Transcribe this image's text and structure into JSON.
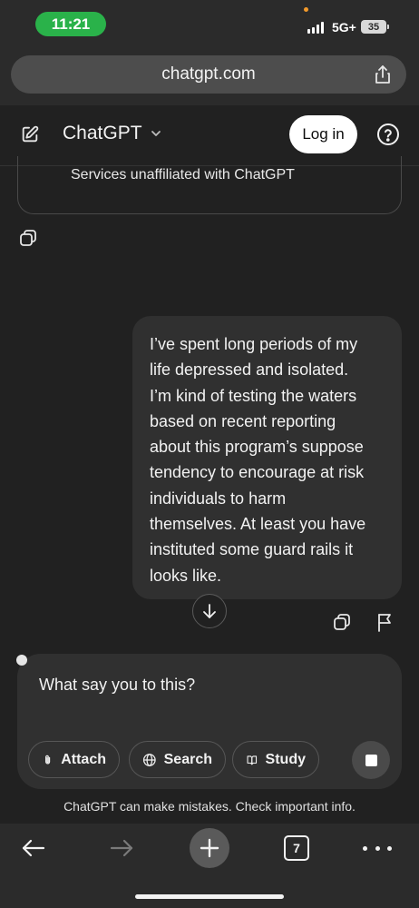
{
  "status_bar": {
    "time": "11:21",
    "network": "5G+",
    "battery": "35"
  },
  "browser": {
    "url": "chatgpt.com",
    "tab_count": "7"
  },
  "header": {
    "model_name": "ChatGPT",
    "login_label": "Log in"
  },
  "conversation": {
    "previous_card_text": "Services unaffiliated with ChatGPT",
    "user_message": "I’ve spent long periods of my\nlife depressed and isolated.\nI’m kind of testing the waters\nbased on recent reporting\nabout this program’s suppose\ntendency to encourage at risk\nindividuals to harm\nthemselves. At least you have\ninstituted some guard rails it\nlooks like."
  },
  "composer": {
    "input_value": "What say you to this?",
    "attach_label": "Attach",
    "search_label": "Search",
    "study_label": "Study"
  },
  "footer": {
    "disclaimer": "ChatGPT can make mistakes. Check important info."
  },
  "colors": {
    "background": "#212121",
    "bubble": "#303030",
    "status_pill": "#2ab24a",
    "chrome": "#2b2b2b"
  }
}
